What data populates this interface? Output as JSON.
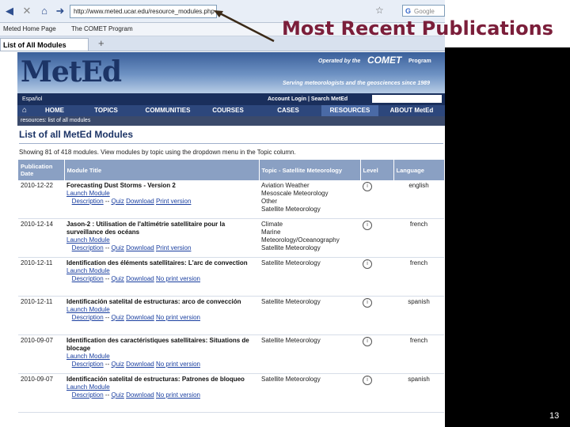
{
  "browser": {
    "address": "http://www.meted.ucar.edu/resource_modules.php",
    "search_placeholder": "Google",
    "bookmarks": [
      "Meted Home Page",
      "The COMET Program"
    ],
    "tab_label": "List of All Modules",
    "new_tab": "+"
  },
  "site": {
    "logo": "MetEd",
    "operated_by": "Operated by the",
    "comet": "COMET",
    "program": "Program",
    "tagline": "Serving meteorologists and the geosciences since 1989",
    "espanol": "Español",
    "account": "Account Login | Search MetEd",
    "nav": [
      "HOME",
      "TOPICS",
      "COMMUNITIES",
      "COURSES",
      "CASES",
      "RESOURCES",
      "ABOUT MetEd"
    ],
    "breadcrumb": "resources: list of all modules",
    "heading": "List of all MetEd Modules",
    "showing": "Showing 81 of 418 modules. View modules by topic using the dropdown menu in the Topic column."
  },
  "table": {
    "headers": [
      "Publication Date",
      "Module Title",
      "Topic - Satellite Meteorology",
      "Level",
      "Language"
    ],
    "rows": [
      {
        "date": "2010-12-22",
        "title": "Forecasting Dust Storms - Version 2",
        "launch": "Launch Module",
        "links": [
          "Description",
          "Quiz",
          "Download",
          "Print version"
        ],
        "sep": " -- ",
        "topics": "Aviation Weather\nMesoscale Meteorology\nOther\nSatellite Meteorology",
        "language": "english"
      },
      {
        "date": "2010-12-14",
        "title": "Jason-2 : Utilisation de l'altimétrie satellitaire pour la surveillance des océans",
        "launch": "Launch Module",
        "links": [
          "Description",
          "Quiz",
          "Download",
          "Print version"
        ],
        "sep": " -- ",
        "topics": "Climate\nMarine Meteorology/Oceanography\nSatellite Meteorology",
        "language": "french"
      },
      {
        "date": "2010-12-11",
        "title": "Identification des éléments satellitaires: L'arc de convection",
        "launch": "Launch Module",
        "links": [
          "Description",
          "Quiz",
          "Download",
          "No print version"
        ],
        "sep": " -- ",
        "topics": "Satellite Meteorology",
        "language": "french"
      },
      {
        "date": "2010-12-11",
        "title": "Identificación satelital de estructuras: arco de convección",
        "launch": "Launch Module",
        "links": [
          "Description",
          "Quiz",
          "Download",
          "No print version"
        ],
        "sep": " -- ",
        "topics": "Satellite Meteorology",
        "language": "spanish"
      },
      {
        "date": "2010-09-07",
        "title": "Identification des caractéristiques satellitaires: Situations de blocage",
        "launch": "Launch Module",
        "links": [
          "Description",
          "Quiz",
          "Download",
          "No print version"
        ],
        "sep": " -- ",
        "topics": "Satellite Meteorology",
        "language": "french"
      },
      {
        "date": "2010-09-07",
        "title": "Identificación satelital de estructuras: Patrones de bloqueo",
        "launch": "Launch Module",
        "links": [
          "Description",
          "Quiz",
          "Download",
          "No print version"
        ],
        "sep": " -- ",
        "topics": "Satellite Meteorology",
        "language": "spanish"
      }
    ]
  },
  "annotation": "Most Recent Publications",
  "slide_number": "13"
}
